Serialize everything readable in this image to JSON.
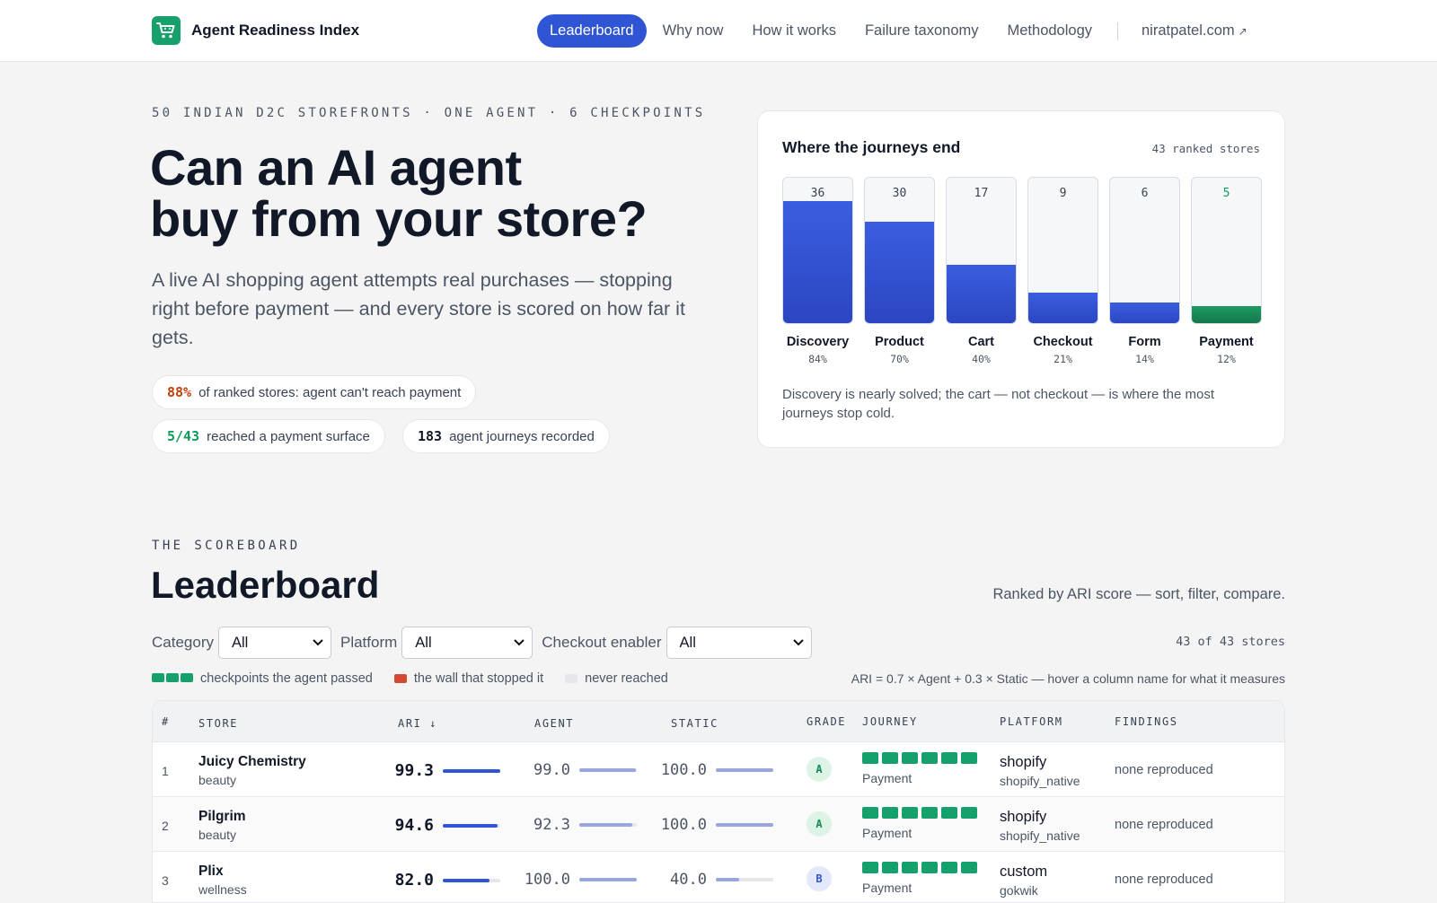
{
  "nav": {
    "brand": "Agent Readiness Index",
    "items": [
      {
        "label": "Leaderboard",
        "active": true
      },
      {
        "label": "Why now"
      },
      {
        "label": "How it works"
      },
      {
        "label": "Failure taxonomy"
      },
      {
        "label": "Methodology"
      }
    ],
    "external": "niratpatel.com",
    "accent": "#2f55d4",
    "logo_color": "#16a06c"
  },
  "hero": {
    "kicker": "50 INDIAN D2C STOREFRONTS · ONE AGENT · 6 CHECKPOINTS",
    "title_line1": "Can an AI agent",
    "title_line2": "buy from your store?",
    "subtitle": "A live AI shopping agent attempts real purchases — stopping right before payment — and every store is scored on how far it gets.",
    "stats": [
      {
        "num": "88%",
        "text": "of ranked stores: agent can't reach payment",
        "color": "#c2410c"
      },
      {
        "num": "5/43",
        "text": "reached a payment surface",
        "color": "#0f9a5c"
      },
      {
        "num": "183",
        "text": "agent journeys recorded",
        "color": "#111827"
      }
    ]
  },
  "funnel": {
    "title": "Where the journeys end",
    "meta": "43 ranked stores",
    "note": "Discovery is nearly solved; the cart — not checkout — is where the most journeys stop cold.",
    "stages": [
      {
        "name": "Discovery",
        "count": 36,
        "pct": "84%",
        "fill": 0.84
      },
      {
        "name": "Product",
        "count": 30,
        "pct": "70%",
        "fill": 0.7
      },
      {
        "name": "Cart",
        "count": 17,
        "pct": "40%",
        "fill": 0.4
      },
      {
        "name": "Checkout",
        "count": 9,
        "pct": "21%",
        "fill": 0.21
      },
      {
        "name": "Form",
        "count": 6,
        "pct": "14%",
        "fill": 0.14
      },
      {
        "name": "Payment",
        "count": 5,
        "pct": "12%",
        "fill": 0.12
      }
    ]
  },
  "scoreboard": {
    "kicker": "THE SCOREBOARD",
    "title": "Leaderboard",
    "subtitle": "Ranked by ARI score — sort, filter, compare.",
    "filters": {
      "category_label": "Category",
      "category_value": "All",
      "platform_label": "Platform",
      "platform_value": "All",
      "enabler_label": "Checkout enabler",
      "enabler_value": "All"
    },
    "count": "43 of 43 stores",
    "legend": {
      "passed": "checkpoints the agent passed",
      "wall": "the wall that stopped it",
      "never": "never reached"
    },
    "formula": "ARI = 0.7 × Agent + 0.3 × Static — hover a column name for what it measures",
    "columns": {
      "rank": "#",
      "store": "STORE",
      "ari": "ARI ↓",
      "agent": "AGENT",
      "static": "STATIC",
      "grade": "GRADE",
      "journey": "JOURNEY",
      "platform": "PLATFORM",
      "findings": "FINDINGS"
    },
    "rows": [
      {
        "rank": "1",
        "store": "Juicy Chemistry",
        "category": "beauty",
        "ari": "99.3",
        "ari_frac": 0.993,
        "agent": "99.0",
        "agent_frac": 0.99,
        "static": "100.0",
        "static_frac": 1.0,
        "grade": "A",
        "journey_passed": 6,
        "journey_label": "Payment",
        "platform": "shopify",
        "enabler": "shopify_native",
        "findings": "none reproduced"
      },
      {
        "rank": "2",
        "store": "Pilgrim",
        "category": "beauty",
        "ari": "94.6",
        "ari_frac": 0.946,
        "agent": "92.3",
        "agent_frac": 0.923,
        "static": "100.0",
        "static_frac": 1.0,
        "grade": "A",
        "journey_passed": 6,
        "journey_label": "Payment",
        "platform": "shopify",
        "enabler": "shopify_native",
        "findings": "none reproduced"
      },
      {
        "rank": "3",
        "store": "Plix",
        "category": "wellness",
        "ari": "82.0",
        "ari_frac": 0.82,
        "agent": "100.0",
        "agent_frac": 1.0,
        "static": "40.0",
        "static_frac": 0.4,
        "grade": "B",
        "journey_passed": 6,
        "journey_label": "Payment",
        "platform": "custom",
        "enabler": "gokwik",
        "findings": "none reproduced"
      }
    ]
  }
}
